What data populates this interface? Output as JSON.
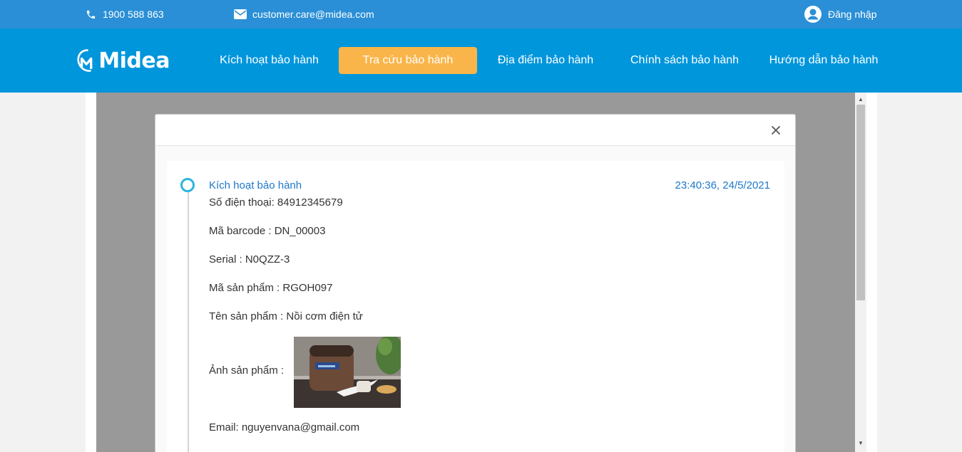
{
  "topbar": {
    "phone": "1900 588 863",
    "email": "customer.care@midea.com",
    "login": "Đăng nhập"
  },
  "brand": {
    "logo": "Midea"
  },
  "nav": {
    "items": [
      {
        "label": "Kích hoạt bảo hành"
      },
      {
        "label": "Tra cứu bảo hành",
        "active": true
      },
      {
        "label": "Địa điểm bảo hành"
      },
      {
        "label": "Chính sách bảo hành"
      },
      {
        "label": "Hướng dẫn bảo hành"
      }
    ]
  },
  "modal": {
    "close_icon": "close-icon",
    "event": {
      "title": "Kích hoạt bảo hành",
      "time": "23:40:36, 24/5/2021",
      "fields": {
        "phone": "Số điện thoại: 84912345679",
        "barcode": "Mã barcode : DN_00003",
        "serial": "Serial : N0QZZ-3",
        "product_code": "Mã sản phẩm : RGOH097",
        "product_name": "Tên sản phẩm : Nồi cơm điện tử",
        "product_image_label": "Ảnh sản phẩm :",
        "email": "Email: nguyenvana@gmail.com"
      }
    }
  },
  "colors": {
    "topbar": "#2a8fd6",
    "nav": "#0096dc",
    "active_tab": "#f9b54a",
    "accent_text": "#1e78c8",
    "timeline_dot": "#2cb5e0"
  }
}
